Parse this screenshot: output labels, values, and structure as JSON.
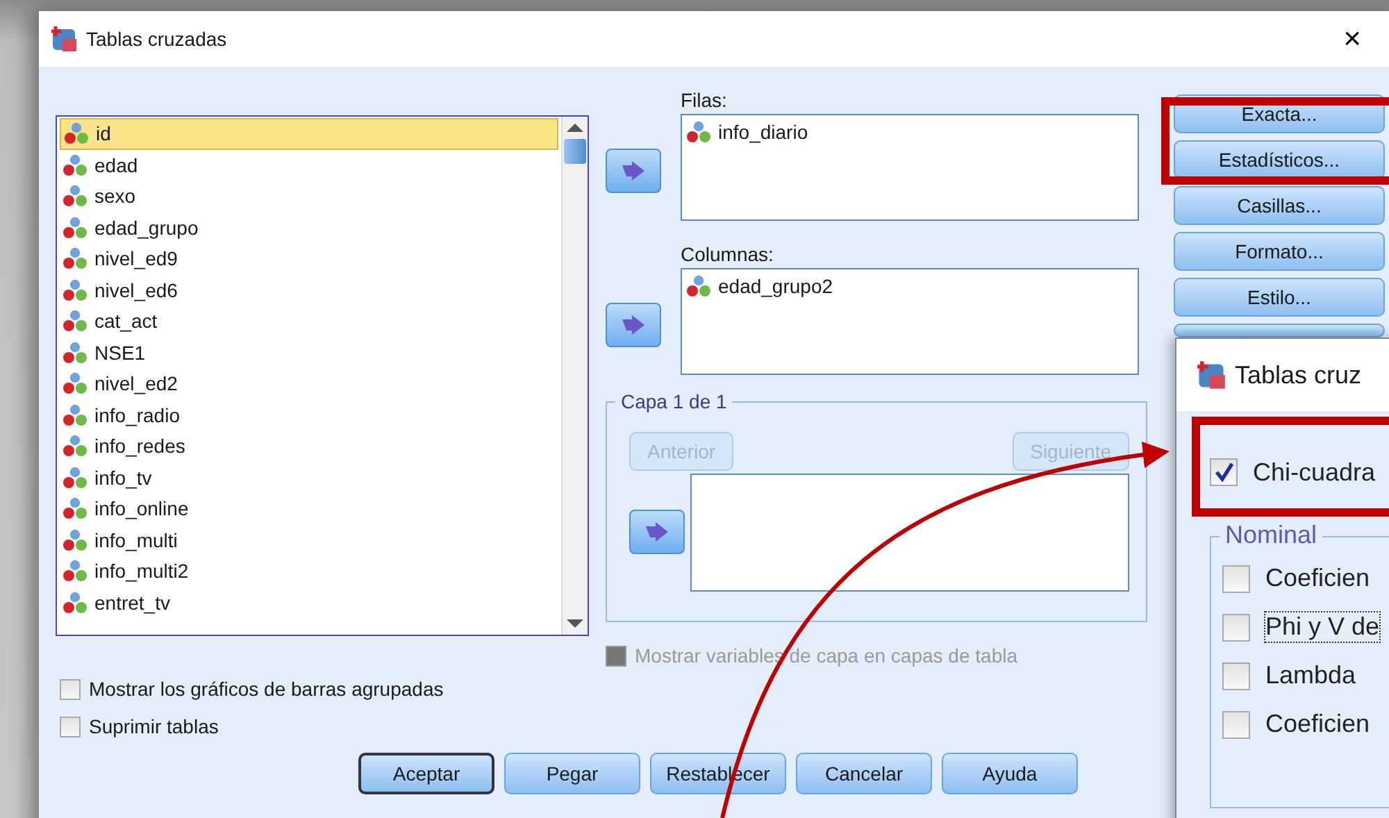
{
  "window": {
    "title": "Tablas cruzadas",
    "close": "×"
  },
  "variables": [
    {
      "name": "id",
      "selected": true
    },
    {
      "name": "edad",
      "selected": false
    },
    {
      "name": "sexo",
      "selected": false
    },
    {
      "name": "edad_grupo",
      "selected": false
    },
    {
      "name": "nivel_ed9",
      "selected": false
    },
    {
      "name": "nivel_ed6",
      "selected": false
    },
    {
      "name": "cat_act",
      "selected": false
    },
    {
      "name": "NSE1",
      "selected": false
    },
    {
      "name": "nivel_ed2",
      "selected": false
    },
    {
      "name": "info_radio",
      "selected": false
    },
    {
      "name": "info_redes",
      "selected": false
    },
    {
      "name": "info_tv",
      "selected": false
    },
    {
      "name": "info_online",
      "selected": false
    },
    {
      "name": "info_multi",
      "selected": false
    },
    {
      "name": "info_multi2",
      "selected": false
    },
    {
      "name": "entret_tv",
      "selected": false
    }
  ],
  "rows_box": {
    "label": "Filas:",
    "items": [
      "info_diario"
    ]
  },
  "columns_box": {
    "label": "Columnas:",
    "items": [
      "edad_grupo2"
    ]
  },
  "layer": {
    "title": "Capa 1 de 1",
    "previous": {
      "label": "Anterior",
      "disabled": true
    },
    "next": {
      "label": "Siguiente",
      "disabled": true
    }
  },
  "layer_option": {
    "label": "Mostrar variables de capa en capas de tabla",
    "checked": false,
    "disabled": true
  },
  "side_buttons": [
    "Exacta...",
    "Estadísticos...",
    "Casillas...",
    "Formato...",
    "Estilo..."
  ],
  "options": [
    {
      "label": "Mostrar los gráficos de barras agrupadas",
      "checked": false
    },
    {
      "label": "Suprimir tablas",
      "checked": false
    }
  ],
  "buttons": [
    {
      "label": "Aceptar",
      "default": true
    },
    {
      "label": "Pegar",
      "default": false
    },
    {
      "label": "Restablecer",
      "default": false
    },
    {
      "label": "Cancelar",
      "default": false
    },
    {
      "label": "Ayuda",
      "default": false
    }
  ],
  "overlay_dialog": {
    "title": "Tablas cruz",
    "chi_square": {
      "label": "Chi-cuadra",
      "checked": true
    },
    "nominal": {
      "title": "Nominal",
      "options": [
        {
          "label": "Coeficien",
          "checked": false,
          "focused": false
        },
        {
          "label": "Phi y V de",
          "checked": false,
          "focused": true
        },
        {
          "label": "Lambda",
          "checked": false,
          "focused": false
        },
        {
          "label": "Coeficien",
          "checked": false,
          "focused": false
        }
      ]
    }
  }
}
